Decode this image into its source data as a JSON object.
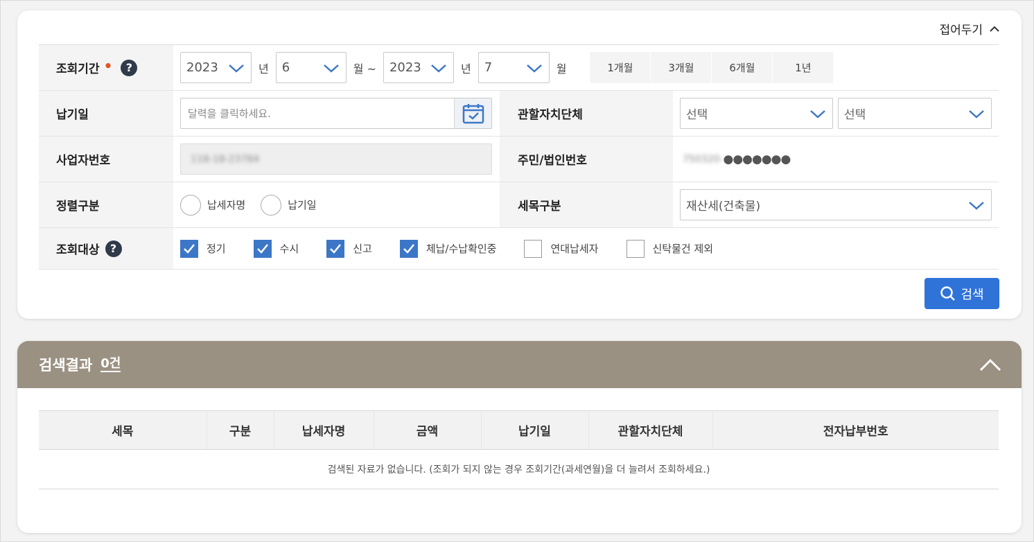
{
  "filter": {
    "fold_label": "접어두기",
    "period": {
      "label": "조회기간",
      "required_mark": "•",
      "help": "?",
      "start_year": "2023",
      "start_month": "6",
      "end_year": "2023",
      "end_month": "7",
      "unit_year": "년",
      "unit_month_range": "월 ~",
      "unit_month": "월",
      "quick": [
        "1개월",
        "3개월",
        "6개월",
        "1년"
      ]
    },
    "pay_date": {
      "label": "납기일",
      "placeholder": "달력을 클릭하세요."
    },
    "jurisdiction": {
      "label": "관할자치단체",
      "select1": "선택",
      "select2": "선택"
    },
    "biz_no": {
      "label": "사업자번호",
      "value": "118-18-23784"
    },
    "resident_no": {
      "label": "주민/법인번호",
      "value_masked_prefix": "750320-",
      "value_dots": "●●●●●●●"
    },
    "sort": {
      "label": "정렬구분",
      "options": [
        "납세자명",
        "납기일"
      ]
    },
    "tax_item": {
      "label": "세목구분",
      "value": "재산세(건축물)"
    },
    "target": {
      "label": "조회대상",
      "help": "?",
      "options": [
        {
          "label": "정기",
          "checked": true
        },
        {
          "label": "수시",
          "checked": true
        },
        {
          "label": "신고",
          "checked": true
        },
        {
          "label": "체납/수납확인중",
          "checked": true
        },
        {
          "label": "연대납세자",
          "checked": false
        },
        {
          "label": "신탁물건 제외",
          "checked": false
        }
      ]
    },
    "search_label": "검색"
  },
  "results": {
    "title": "검색결과",
    "count": "0건",
    "columns": [
      "세목",
      "구분",
      "납세자명",
      "금액",
      "납기일",
      "관할자치단체",
      "전자납부번호"
    ],
    "empty_message": "검색된 자료가 없습니다. (조회가 되지 않는 경우 조회기간(과세연월)을 더 늘려서 조회하세요.)"
  },
  "colors": {
    "accent": "#2f73d9",
    "checkbox": "#3c77c7",
    "result_header": "#9b9182",
    "required": "#e2561f"
  }
}
